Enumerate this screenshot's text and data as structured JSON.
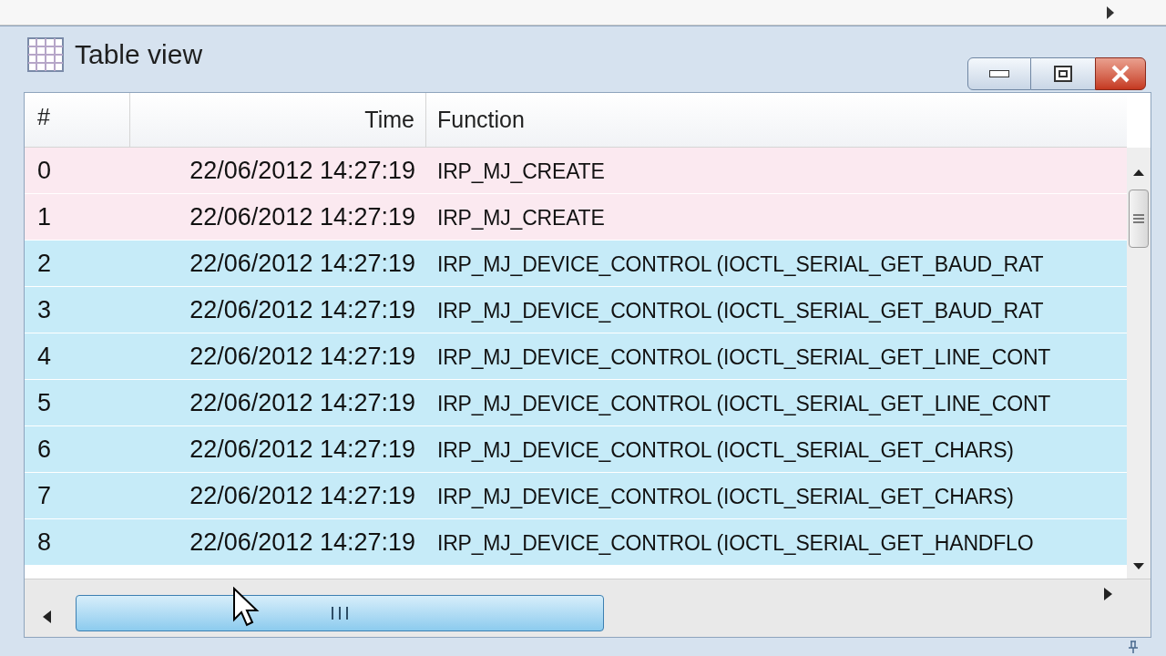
{
  "window": {
    "title": "Table view"
  },
  "table": {
    "columns": [
      "#",
      "Time",
      "Function"
    ],
    "rows": [
      {
        "index": "0",
        "time": "22/06/2012 14:27:19",
        "function": "IRP_MJ_CREATE",
        "color": "#fbe9f0"
      },
      {
        "index": "1",
        "time": "22/06/2012 14:27:19",
        "function": "IRP_MJ_CREATE",
        "color": "#fbe9f0"
      },
      {
        "index": "2",
        "time": "22/06/2012 14:27:19",
        "function": "IRP_MJ_DEVICE_CONTROL (IOCTL_SERIAL_GET_BAUD_RAT",
        "color": "#c6ebf8"
      },
      {
        "index": "3",
        "time": "22/06/2012 14:27:19",
        "function": "IRP_MJ_DEVICE_CONTROL (IOCTL_SERIAL_GET_BAUD_RAT",
        "color": "#c6ebf8"
      },
      {
        "index": "4",
        "time": "22/06/2012 14:27:19",
        "function": "IRP_MJ_DEVICE_CONTROL (IOCTL_SERIAL_GET_LINE_CONT",
        "color": "#c6ebf8"
      },
      {
        "index": "5",
        "time": "22/06/2012 14:27:19",
        "function": "IRP_MJ_DEVICE_CONTROL (IOCTL_SERIAL_GET_LINE_CONT",
        "color": "#c6ebf8"
      },
      {
        "index": "6",
        "time": "22/06/2012 14:27:19",
        "function": "IRP_MJ_DEVICE_CONTROL (IOCTL_SERIAL_GET_CHARS)",
        "color": "#c6ebf8"
      },
      {
        "index": "7",
        "time": "22/06/2012 14:27:19",
        "function": "IRP_MJ_DEVICE_CONTROL (IOCTL_SERIAL_GET_CHARS)",
        "color": "#c6ebf8"
      },
      {
        "index": "8",
        "time": "22/06/2012 14:27:19",
        "function": "IRP_MJ_DEVICE_CONTROL (IOCTL_SERIAL_GET_HANDFLO",
        "color": "#c6ebf8"
      }
    ]
  }
}
